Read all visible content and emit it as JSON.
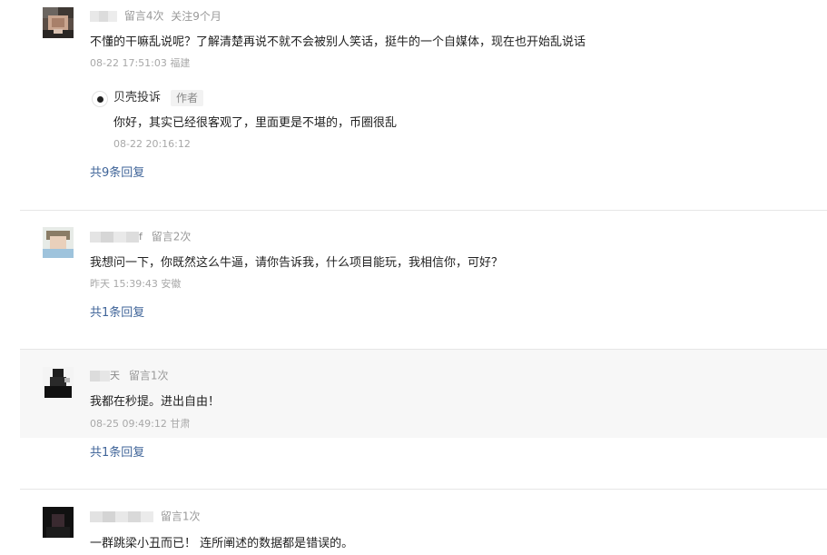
{
  "comments": [
    {
      "tag1": "留言4次",
      "tag2": "关注9个月",
      "text": "不懂的干嘛乱说呢？了解清楚再说不就不会被别人笑话，挺牛的一个自媒体，现在也开始乱说话",
      "time": "08-22 17:51:03 福建",
      "author_reply": {
        "name": "贝壳投诉",
        "badge": "作者",
        "text": "你好，其实已经很客观了，里面更是不堪的，币圈很乱",
        "time": "08-22 20:16:12"
      },
      "replies_label": "共9条回复"
    },
    {
      "name_tail": "f",
      "tag1": "留言2次",
      "text": "我想问一下，你既然这么牛逼，请你告诉我，什么项目能玩，我相信你，可好？",
      "time": "昨天 15:39:43 安徽",
      "replies_label": "共1条回复"
    },
    {
      "name_tail": "天",
      "tag1": "留言1次",
      "text": "我都在秒提。进出自由！",
      "time": "08-25 09:49:12 甘肃",
      "replies_label": "共1条回复"
    },
    {
      "tag1": "留言1次",
      "text": "一群跳梁小丑而已！ 连所阐述的数据都是错误的。"
    }
  ],
  "icons": {
    "author_logo": "shell-logo-icon"
  },
  "colors": {
    "reply_link": "#406599",
    "highlight_bg": "#f7f7f7",
    "separator": "#e6e6e6"
  }
}
